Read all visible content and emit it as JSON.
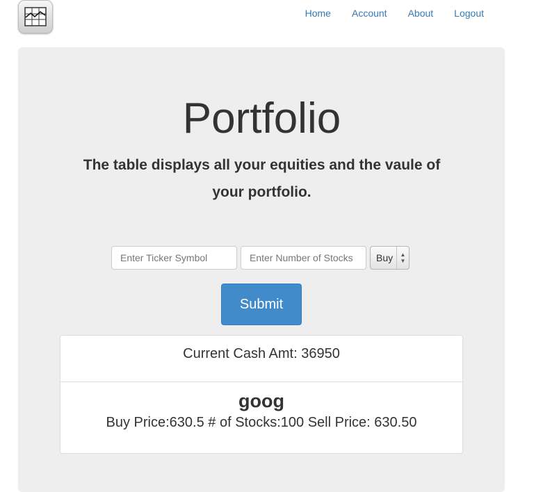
{
  "nav": {
    "logo_icon": "line-chart-icon",
    "links": [
      {
        "label": "Home"
      },
      {
        "label": "Account"
      },
      {
        "label": "About"
      },
      {
        "label": "Logout"
      }
    ]
  },
  "main": {
    "title": "Portfolio",
    "subtitle": "The table displays all your equities and the vaule of your portfolio."
  },
  "form": {
    "ticker_placeholder": "Enter Ticker Symbol",
    "count_placeholder": "Enter Number of Stocks",
    "action_selected": "Buy",
    "submit_label": "Submit"
  },
  "portfolio": {
    "cash_text": "Current Cash Amt: 36950",
    "stocks": [
      {
        "name": "goog",
        "details": "Buy Price:630.5 # of Stocks:100 Sell Price: 630.50"
      }
    ]
  },
  "colors": {
    "accent": "#428bca",
    "link": "#337ab7",
    "jumbotron_bg": "#eeeeee"
  }
}
